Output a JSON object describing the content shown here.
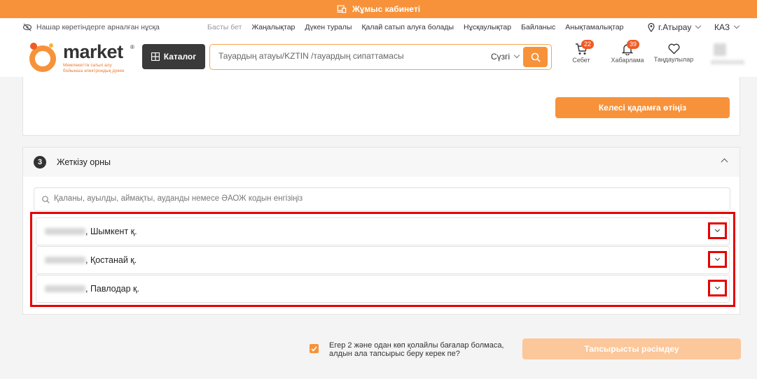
{
  "topbar": {
    "label": "Жұмыс кабинеті"
  },
  "util": {
    "accessibility": "Нашар көретіндерге арналған нұсқа",
    "nav": [
      "Басты бет",
      "Жаңалықтар",
      "Дүкен туралы",
      "Қалай сатып алуға болады",
      "Нұсқаулықтар",
      "Байланыс",
      "Анықтамалықтар"
    ],
    "city": "г.Атырау",
    "lang": "КАЗ"
  },
  "header": {
    "logo_word": "market",
    "logo_reg": "®",
    "logo_tag_line1": "Мемлекеттік сатып алу",
    "logo_tag_line2": "бойынша электрондық дүкен",
    "catalog": "Каталог",
    "search_placeholder": "Тауардың атауы/KZTIN /тауардың сипаттамасы",
    "filter": "Сүзгі",
    "cart": {
      "label": "Себет",
      "count": "22"
    },
    "notifications": {
      "label": "Хабарлама",
      "count": "39"
    },
    "favorites": {
      "label": "Таңдаулылар"
    }
  },
  "step2": {
    "next_button": "Келесі қадамға өтіңіз"
  },
  "step3": {
    "number": "3",
    "title": "Жеткізу орны",
    "search_placeholder": "Қаланы, ауылды, аймақты, ауданды немесе ӘАОЖ кодын енгізіңіз",
    "locations": [
      {
        "city": ", Шымкент қ."
      },
      {
        "city": ", Қостанай қ."
      },
      {
        "city": ", Павлодар қ."
      }
    ]
  },
  "footer": {
    "checkbox_line1": "Егер 2 және одан көп қолайлы бағалар болмаса,",
    "checkbox_line2": "алдын ала тапсырыс беру керек пе?",
    "order_button": "Тапсырысты рәсімдеу"
  },
  "colors": {
    "accent": "#f7923a",
    "highlight": "#e60000",
    "badge": "#f15a24"
  }
}
